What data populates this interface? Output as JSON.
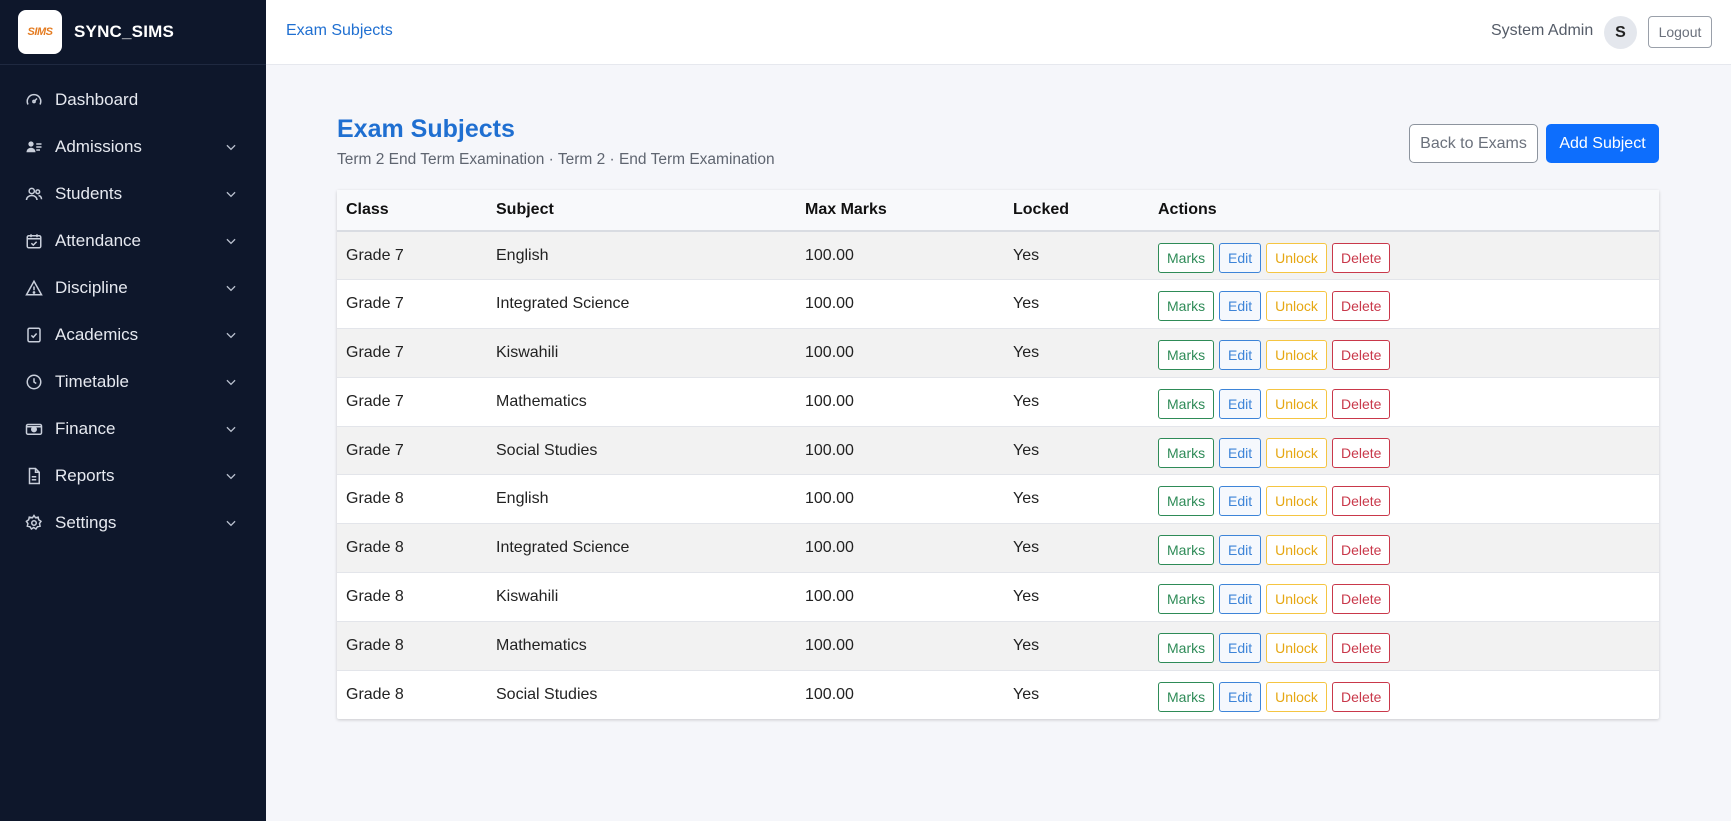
{
  "brand": {
    "name": "SYNC_SIMS",
    "logo_text": "SIMS"
  },
  "sidebar": {
    "items": [
      {
        "label": "Dashboard",
        "icon": "gauge-icon",
        "has_chevron": false
      },
      {
        "label": "Admissions",
        "icon": "user-list-icon",
        "has_chevron": true
      },
      {
        "label": "Students",
        "icon": "users-icon",
        "has_chevron": true
      },
      {
        "label": "Attendance",
        "icon": "calendar-check-icon",
        "has_chevron": true
      },
      {
        "label": "Discipline",
        "icon": "warning-triangle-icon",
        "has_chevron": true
      },
      {
        "label": "Academics",
        "icon": "clipboard-check-icon",
        "has_chevron": true
      },
      {
        "label": "Timetable",
        "icon": "clock-icon",
        "has_chevron": true
      },
      {
        "label": "Finance",
        "icon": "cash-icon",
        "has_chevron": true
      },
      {
        "label": "Reports",
        "icon": "document-icon",
        "has_chevron": true
      },
      {
        "label": "Settings",
        "icon": "gear-icon",
        "has_chevron": true
      }
    ]
  },
  "header": {
    "breadcrumb": "Exam Subjects",
    "user_name": "System Admin",
    "avatar_initial": "S",
    "logout_label": "Logout"
  },
  "main": {
    "title": "Exam Subjects",
    "subtitle": "Term 2 End Term Examination · Term 2 · End Term Examination",
    "back_label": "Back to Exams",
    "add_label": "Add Subject"
  },
  "table": {
    "columns": [
      "Class",
      "Subject",
      "Max Marks",
      "Locked",
      "Actions"
    ],
    "action_labels": {
      "marks": "Marks",
      "edit": "Edit",
      "unlock": "Unlock",
      "delete": "Delete"
    },
    "rows": [
      {
        "class": "Grade 7",
        "subject": "English",
        "max_marks": "100.00",
        "locked": "Yes"
      },
      {
        "class": "Grade 7",
        "subject": "Integrated Science",
        "max_marks": "100.00",
        "locked": "Yes"
      },
      {
        "class": "Grade 7",
        "subject": "Kiswahili",
        "max_marks": "100.00",
        "locked": "Yes"
      },
      {
        "class": "Grade 7",
        "subject": "Mathematics",
        "max_marks": "100.00",
        "locked": "Yes"
      },
      {
        "class": "Grade 7",
        "subject": "Social Studies",
        "max_marks": "100.00",
        "locked": "Yes"
      },
      {
        "class": "Grade 8",
        "subject": "English",
        "max_marks": "100.00",
        "locked": "Yes"
      },
      {
        "class": "Grade 8",
        "subject": "Integrated Science",
        "max_marks": "100.00",
        "locked": "Yes"
      },
      {
        "class": "Grade 8",
        "subject": "Kiswahili",
        "max_marks": "100.00",
        "locked": "Yes"
      },
      {
        "class": "Grade 8",
        "subject": "Mathematics",
        "max_marks": "100.00",
        "locked": "Yes"
      },
      {
        "class": "Grade 8",
        "subject": "Social Studies",
        "max_marks": "100.00",
        "locked": "Yes"
      }
    ]
  },
  "colors": {
    "sidebar_bg": "#0e172b",
    "primary": "#0d6efd",
    "title_blue": "#1f6fd1",
    "marks": "#2e8b57",
    "edit": "#3d84d8",
    "unlock": "#f5c542",
    "delete": "#c9384a"
  }
}
